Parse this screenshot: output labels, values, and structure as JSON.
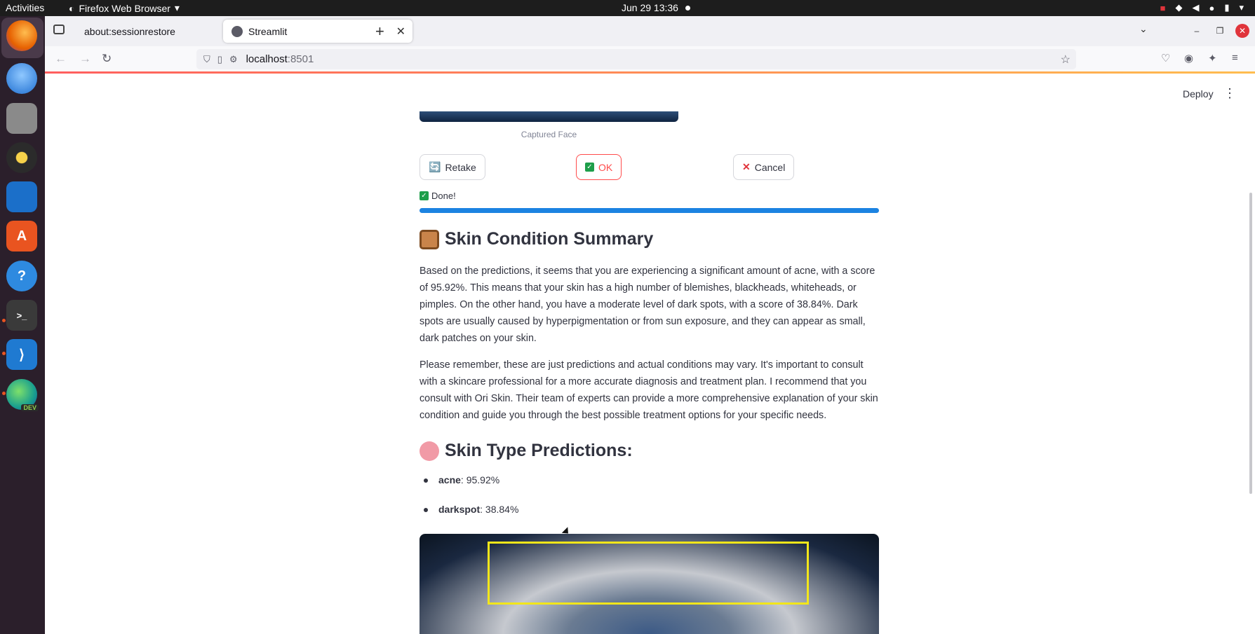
{
  "topbar": {
    "activities": "Activities",
    "app_menu": "Firefox Web Browser",
    "clock": "Jun 29  13:36"
  },
  "dock": {
    "items": [
      "firefox",
      "thunderbird",
      "files",
      "rhythmbox",
      "libreoffice-writer",
      "app-center",
      "help",
      "terminal",
      "vscode",
      "edge-dev"
    ],
    "edge_badge": "DEV"
  },
  "browser": {
    "tabs": [
      {
        "label": "about:sessionrestore"
      },
      {
        "label": "Streamlit"
      }
    ],
    "url_host": "localhost",
    "url_port": ":8501"
  },
  "app": {
    "deploy_label": "Deploy",
    "image_caption": "Captured Face",
    "buttons": {
      "retake": "Retake",
      "ok": "OK",
      "cancel": "Cancel"
    },
    "status": "Done!",
    "progress": 1.0,
    "summary_title": "Skin Condition Summary",
    "summary_p1": "Based on the predictions, it seems that you are experiencing a significant amount of acne, with a score of 95.92%. This means that your skin has a high number of blemishes, blackheads, whiteheads, or pimples. On the other hand, you have a moderate level of dark spots, with a score of 38.84%. Dark spots are usually caused by hyperpigmentation or from sun exposure, and they can appear as small, dark patches on your skin.",
    "summary_p2": "Please remember, these are just predictions and actual conditions may vary. It's important to consult with a skincare professional for a more accurate diagnosis and treatment plan. I recommend that you consult with Ori Skin. Their team of experts can provide a more comprehensive explanation of your skin condition and guide you through the best possible treatment options for your specific needs.",
    "predictions_title": "Skin Type Predictions:",
    "predictions": [
      {
        "name": "acne",
        "value": ": 95.92%"
      },
      {
        "name": "darkspot",
        "value": ": 38.84%"
      }
    ]
  },
  "colors": {
    "accent_red": "#ff4b4b",
    "progress_blue": "#1c83e1",
    "bbox_yellow": "#f2e61a"
  }
}
